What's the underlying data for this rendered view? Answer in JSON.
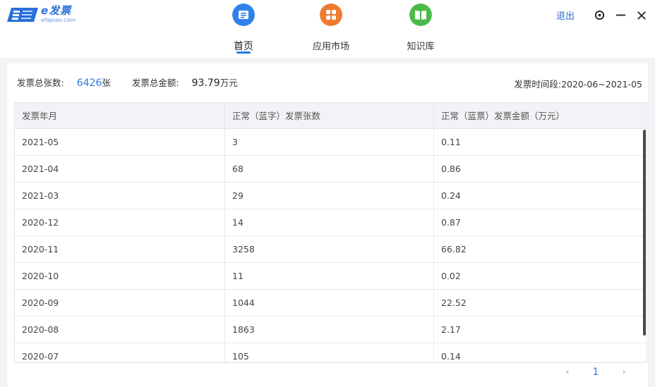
{
  "app": {
    "logo_title": "e发票",
    "logo_sub": "efapiao.com"
  },
  "nav": [
    {
      "label": "首页",
      "icon": "home-doc-icon",
      "color": "#2f80ed",
      "active": true
    },
    {
      "label": "应用市场",
      "icon": "app-grid-icon",
      "color": "#f07a30",
      "active": false
    },
    {
      "label": "知识库",
      "icon": "book-icon",
      "color": "#4cba4a",
      "active": false
    }
  ],
  "window": {
    "logout_label": "退出",
    "settings_icon": "settings-icon",
    "minimize_icon": "minimize-icon",
    "close_icon": "close-icon"
  },
  "stats": {
    "total_count_label": "发票总张数:",
    "total_count_value": "6426",
    "total_count_unit": "张",
    "total_amount_label": "发票总金额:",
    "total_amount_value": "93.79",
    "total_amount_unit": "万元",
    "period_label": "发票时间段:",
    "period_value": "2020-06~2021-05"
  },
  "table": {
    "headers": [
      "发票年月",
      "正常（蓝字）发票张数",
      "正常（蓝票）发票金额（万元）"
    ],
    "rows": [
      [
        "2021-05",
        "3",
        "0.11"
      ],
      [
        "2021-04",
        "68",
        "0.86"
      ],
      [
        "2021-03",
        "29",
        "0.24"
      ],
      [
        "2020-12",
        "14",
        "0.87"
      ],
      [
        "2020-11",
        "3258",
        "66.82"
      ],
      [
        "2020-10",
        "11",
        "0.02"
      ],
      [
        "2020-09",
        "1044",
        "22.52"
      ],
      [
        "2020-08",
        "1863",
        "2.17"
      ],
      [
        "2020-07",
        "105",
        "0.14"
      ]
    ]
  },
  "pager": {
    "prev": "‹",
    "current": "1",
    "next": "›"
  },
  "colors": {
    "accent": "#2f7be0",
    "header_bg": "#f2f3f6",
    "page_bg": "#f2f3f5"
  }
}
